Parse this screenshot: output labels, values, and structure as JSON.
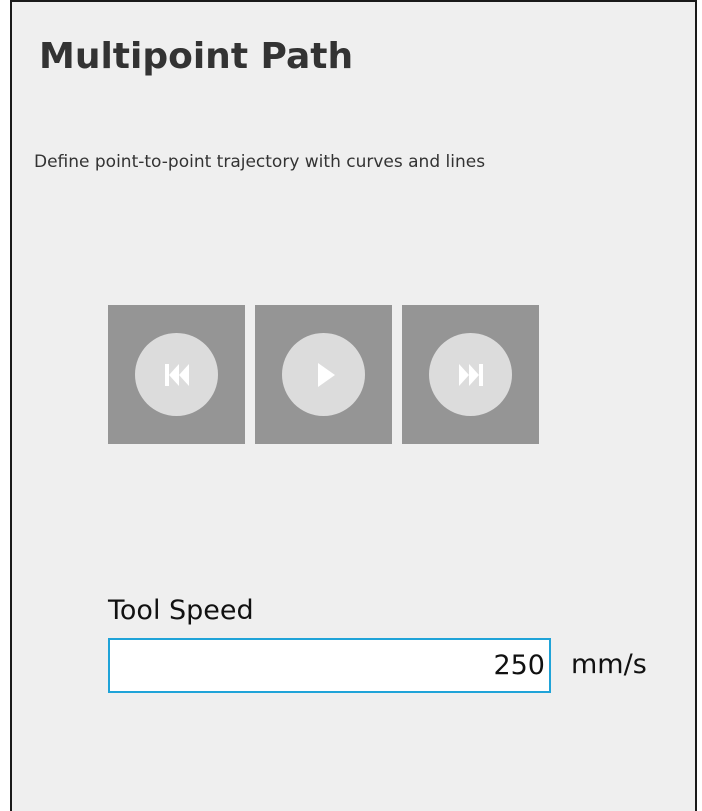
{
  "header": {
    "title": "Multipoint Path",
    "description": "Define point-to-point trajectory with curves and lines"
  },
  "playback": {
    "buttons": [
      {
        "name": "skip-back",
        "icon": "skip-back-icon"
      },
      {
        "name": "play",
        "icon": "play-icon"
      },
      {
        "name": "skip-forward",
        "icon": "skip-forward-icon"
      }
    ]
  },
  "tool_speed": {
    "label": "Tool Speed",
    "value": "250",
    "unit": "mm/s"
  },
  "colors": {
    "panel_background": "#efefef",
    "button_background": "#959595",
    "button_circle": "#dcdcdc",
    "input_focus_border": "#1fa3d8"
  }
}
